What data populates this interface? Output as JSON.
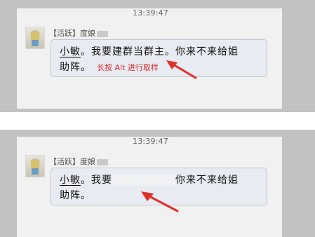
{
  "timestamp": "13:39:47",
  "sender": {
    "badge": "【活跃】",
    "name": "度娘"
  },
  "message_before": {
    "mention": "小敏",
    "text_line1": "。我要建群当群主。你来不来给姐",
    "text_line2": "助阵。",
    "annotation": "长按 Alt 进行取样"
  },
  "message_after": {
    "mention": "小敏",
    "text_line1_start": "。我要",
    "text_line1_end": "你来不来给姐",
    "text_line2": "助阵。"
  },
  "colors": {
    "annotation": "#d42b2b",
    "arrow": "#e0302a",
    "bubble_bg": "#e8ecf2"
  }
}
